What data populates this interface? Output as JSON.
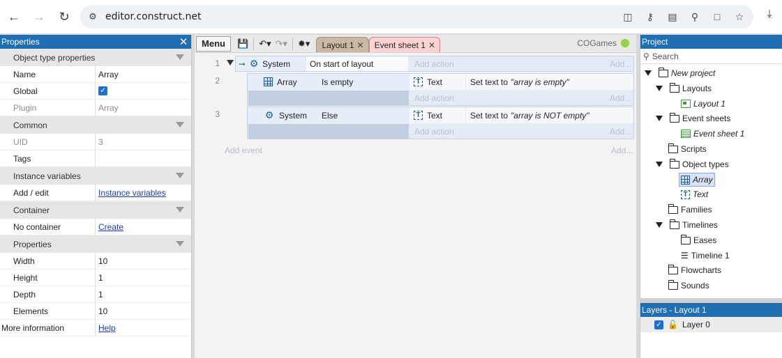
{
  "browser": {
    "url": "editor.construct.net",
    "icons": [
      "back-icon",
      "forward-icon",
      "reload-icon",
      "site-settings-icon",
      "screenshot-icon",
      "key-icon",
      "install-icon",
      "zoom-icon",
      "document-icon",
      "star-icon",
      "download-icon"
    ]
  },
  "properties": {
    "title": "Properties",
    "sections": {
      "object_type": "Object type properties",
      "common": "Common",
      "instance_vars": "Instance variables",
      "container": "Container",
      "props": "Properties"
    },
    "rows": {
      "name_k": "Name",
      "name_v": "Array",
      "global_k": "Global",
      "global_v": true,
      "plugin_k": "Plugin",
      "plugin_v": "Array",
      "uid_k": "UID",
      "uid_v": "3",
      "tags_k": "Tags",
      "tags_v": "",
      "addedit_k": "Add / edit",
      "addedit_v": "Instance variables",
      "nocontainer_k": "No container",
      "nocontainer_v": "Create",
      "width_k": "Width",
      "width_v": "10",
      "height_k": "Height",
      "height_v": "1",
      "depth_k": "Depth",
      "depth_v": "1",
      "elements_k": "Elements",
      "elements_v": "10",
      "moreinfo_k": "More information",
      "moreinfo_v": "Help"
    }
  },
  "toolbar": {
    "menu": "Menu",
    "tabs": [
      {
        "label": "Layout 1"
      },
      {
        "label": "Event sheet 1"
      }
    ],
    "brand": "COGames"
  },
  "events": {
    "e1": {
      "num": "1",
      "object": "System",
      "condition": "On start of layout",
      "add_action": "Add action",
      "add": "Add..."
    },
    "e2": {
      "num": "2",
      "object": "Array",
      "condition": "Is empty",
      "action_object": "Text",
      "action_prefix": "Set text to",
      "action_value": "\"array is empty\"",
      "add_action": "Add action",
      "add": "Add..."
    },
    "e3": {
      "num": "3",
      "object": "System",
      "condition": "Else",
      "action_object": "Text",
      "action_prefix": "Set text to",
      "action_value": "\"array is NOT empty\"",
      "add_action": "Add action",
      "add": "Add..."
    },
    "add_event": "Add event",
    "add_event_more": "Add..."
  },
  "project": {
    "title": "Project",
    "search_placeholder": "Search",
    "tree": {
      "root": "New project",
      "layouts": "Layouts",
      "layout1": "Layout 1",
      "event_sheets": "Event sheets",
      "event_sheet1": "Event sheet 1",
      "scripts": "Scripts",
      "object_types": "Object types",
      "array": "Array",
      "text": "Text",
      "families": "Families",
      "timelines": "Timelines",
      "eases": "Eases",
      "timeline1": "Timeline 1",
      "flowcharts": "Flowcharts",
      "sounds": "Sounds"
    }
  },
  "layers": {
    "title": "Layers - Layout 1",
    "layer0": "Layer 0"
  }
}
